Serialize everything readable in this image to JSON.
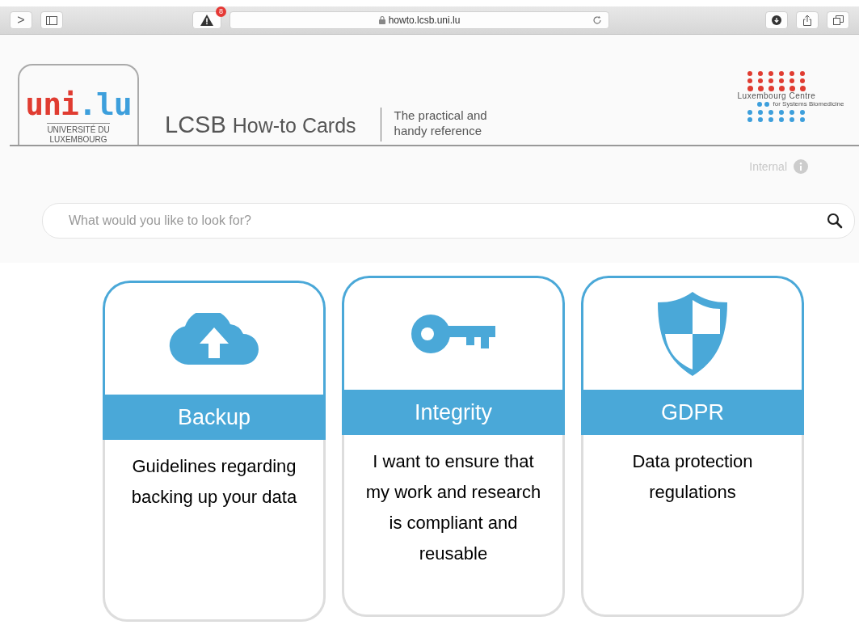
{
  "browser": {
    "back": ">",
    "alerts": "8",
    "url": "howto.lcsb.uni.lu"
  },
  "header": {
    "logo": {
      "mark_left": "uni",
      "mark_right": ".lu",
      "caption": "UNIVERSITÉ DU\nLUXEMBOURG"
    },
    "brand": "LCSB",
    "title": "How-to Cards",
    "tagline": "The practical and\nhandy reference",
    "partner_logo": {
      "line1": "Luxembourg Centre",
      "line2": "for Systems Biomedicine"
    }
  },
  "access": {
    "label": "Internal"
  },
  "search": {
    "placeholder": "What would you like to look for?"
  },
  "cards": [
    {
      "kind": "cloud",
      "title": "Backup",
      "description": "Guidelines regarding backing up your data"
    },
    {
      "kind": "key",
      "title": "Integrity",
      "description": "I want to ensure that my work and research is compliant and reusable"
    },
    {
      "kind": "shield",
      "title": "GDPR",
      "description": "Data protection regulations"
    }
  ]
}
